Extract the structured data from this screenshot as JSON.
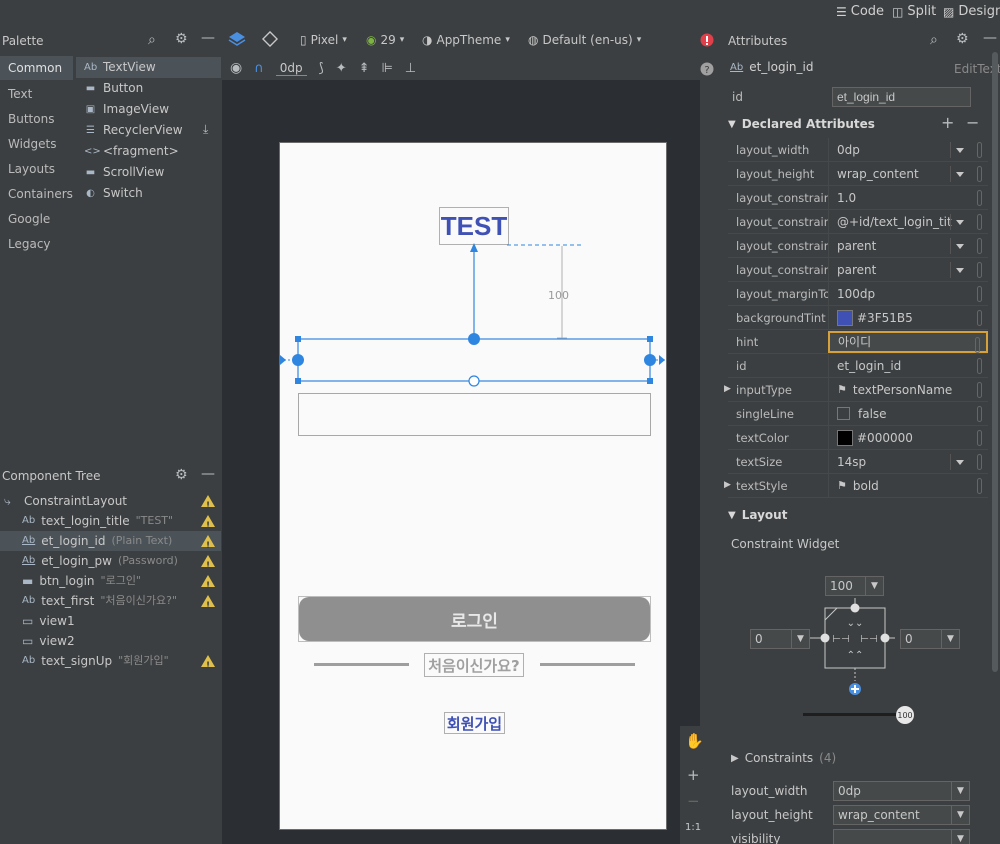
{
  "top_modes": {
    "code": "Code",
    "split": "Split",
    "design": "Design"
  },
  "palette": {
    "title": "Palette",
    "categories": [
      "Common",
      "Text",
      "Buttons",
      "Widgets",
      "Layouts",
      "Containers",
      "Google",
      "Legacy"
    ],
    "items": [
      {
        "icon": "Ab",
        "label": "TextView"
      },
      {
        "icon": "▬",
        "label": "Button"
      },
      {
        "icon": "▣",
        "label": "ImageView"
      },
      {
        "icon": "☰",
        "label": "RecyclerView"
      },
      {
        "icon": "<>",
        "label": "<fragment>"
      },
      {
        "icon": "▬",
        "label": "ScrollView"
      },
      {
        "icon": "◐",
        "label": "Switch"
      }
    ]
  },
  "design_toolbar": {
    "device": "Pixel",
    "api": "29",
    "theme": "AppTheme",
    "locale": "Default (en-us)",
    "margin": "0dp"
  },
  "component_tree": {
    "title": "Component Tree",
    "items": [
      {
        "icon": "⤷",
        "label": "ConstraintLayout",
        "hint": "",
        "warn": true
      },
      {
        "icon": "Ab",
        "label": "text_login_title",
        "hint": "\"TEST\"",
        "warn": true
      },
      {
        "icon": "Ab",
        "label": "et_login_id",
        "hint": "(Plain Text)",
        "warn": true
      },
      {
        "icon": "Ab",
        "label": "et_login_pw",
        "hint": "(Password)",
        "warn": true
      },
      {
        "icon": "▬",
        "label": "btn_login",
        "hint": "\"로그인\"",
        "warn": true
      },
      {
        "icon": "Ab",
        "label": "text_first",
        "hint": "\"처음이신가요?\"",
        "warn": true
      },
      {
        "icon": "▭",
        "label": "view1",
        "hint": "",
        "warn": false
      },
      {
        "icon": "▭",
        "label": "view2",
        "hint": "",
        "warn": false
      },
      {
        "icon": "Ab",
        "label": "text_signUp",
        "hint": "\"회원가입\"",
        "warn": true
      }
    ]
  },
  "preview": {
    "title": "TEST",
    "margin_label": "100",
    "login_button": "로그인",
    "first_text": "처음이신가요?",
    "signup": "회원가입",
    "zoom_ratio": "1:1"
  },
  "attributes": {
    "title": "Attributes",
    "widget_name": "et_login_id",
    "widget_type": "EditText",
    "id_label": "id",
    "id_value": "et_login_id",
    "declared_title": "Declared Attributes",
    "rows": [
      {
        "k": "layout_width",
        "v": "0dp",
        "dd": true
      },
      {
        "k": "layout_height",
        "v": "wrap_content",
        "dd": true
      },
      {
        "k": "layout_constrain...",
        "v": "1.0",
        "dd": false
      },
      {
        "k": "layout_constrain...",
        "v": "@+id/text_login_tit",
        "dd": true
      },
      {
        "k": "layout_constrain...",
        "v": "parent",
        "dd": true
      },
      {
        "k": "layout_constrain...",
        "v": "parent",
        "dd": true
      },
      {
        "k": "layout_marginTo...",
        "v": "100dp",
        "dd": false
      },
      {
        "k": "backgroundTint",
        "v": "#3F51B5",
        "dd": false,
        "swatch": "#3f51b5"
      },
      {
        "k": "hint",
        "v": "아이디",
        "dd": false,
        "focus": true
      },
      {
        "k": "id",
        "v": "et_login_id",
        "dd": false
      },
      {
        "k": "inputType",
        "v": "textPersonName",
        "dd": false,
        "flag": true,
        "expand": true
      },
      {
        "k": "singleLine",
        "v": "false",
        "dd": false,
        "check": true
      },
      {
        "k": "textColor",
        "v": "#000000",
        "dd": false,
        "swatch": "#000000"
      },
      {
        "k": "textSize",
        "v": "14sp",
        "dd": true
      },
      {
        "k": "textStyle",
        "v": "bold",
        "dd": false,
        "flag": true,
        "expand": true
      }
    ],
    "layout_title": "Layout",
    "constraint_widget": "Constraint Widget",
    "cw_top": "100",
    "cw_left": "0",
    "cw_right": "0",
    "cw_bias": "100",
    "constraints_label": "Constraints",
    "constraints_count": "(4)",
    "bottom_rows": [
      {
        "k": "layout_width",
        "v": "0dp"
      },
      {
        "k": "layout_height",
        "v": "wrap_content"
      },
      {
        "k": "visibility",
        "v": ""
      }
    ]
  },
  "colors": {
    "accent": "#3f51b5",
    "selection": "#2f86e0",
    "warning": "#e0c04d"
  }
}
